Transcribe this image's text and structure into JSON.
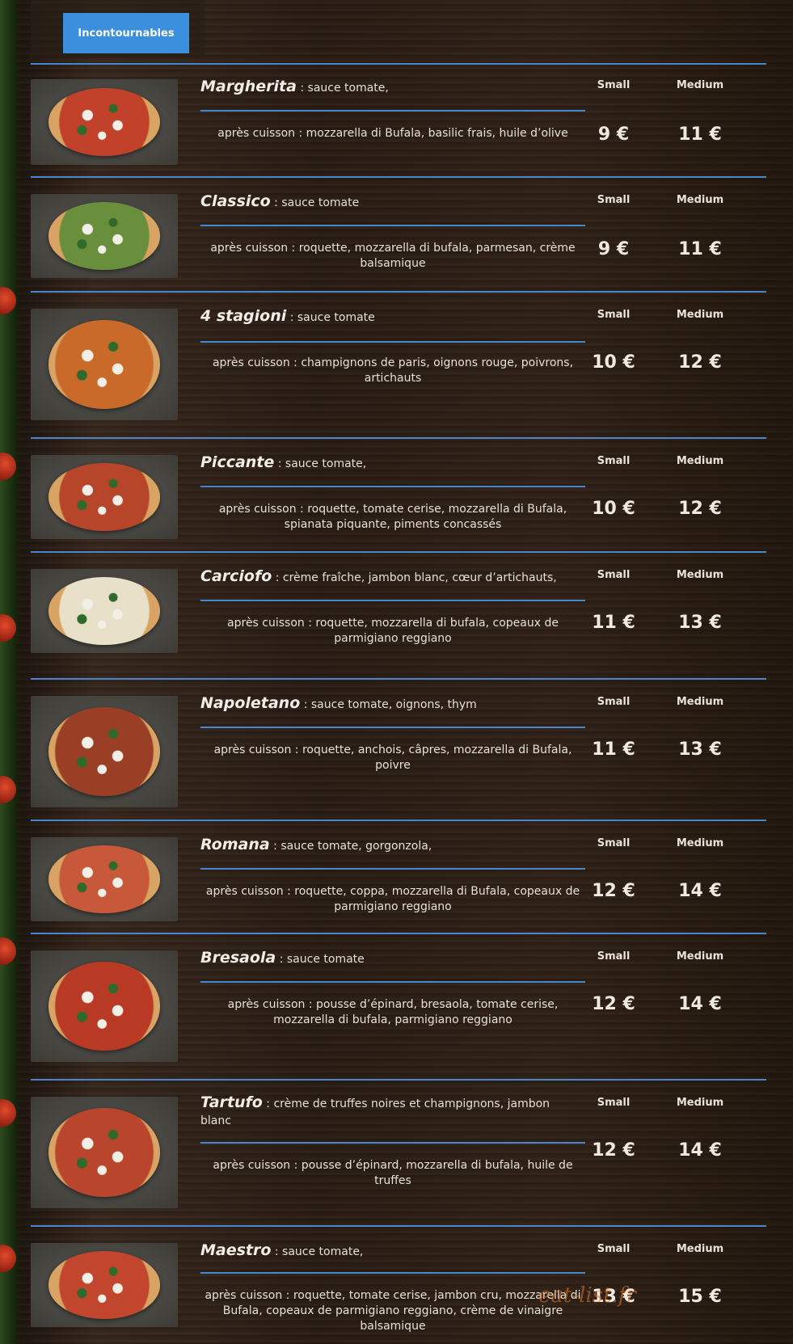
{
  "tab": {
    "label": "Incontournables"
  },
  "size_labels": {
    "small": "Small",
    "medium": "Medium"
  },
  "watermark": "eat-list.fr",
  "items": [
    {
      "name": "Margherita",
      "base": " : sauce tomate,",
      "after": "après cuisson : mozzarella di Bufala, basilic frais, huile d’olive",
      "small": "9 €",
      "medium": "11 €"
    },
    {
      "name": "Classico",
      "base": " : sauce tomate",
      "after": "après cuisson : roquette, mozzarella di bufala, parmesan, crème balsamique",
      "small": "9 €",
      "medium": "11 €"
    },
    {
      "name": "4 stagioni",
      "base": " : sauce tomate",
      "after": "après cuisson : champignons de paris, oignons rouge, poivrons, artichauts",
      "small": "10 €",
      "medium": "12 €"
    },
    {
      "name": "Piccante",
      "base": " : sauce tomate,",
      "after": "après cuisson : roquette, tomate cerise, mozzarella di Bufala, spianata piquante, piments concassés",
      "small": "10 €",
      "medium": "12 €"
    },
    {
      "name": "Carciofo",
      "base": " : crème fraîche, jambon blanc, cœur d’artichauts,",
      "after": "après cuisson : roquette, mozzarella di bufala, copeaux de parmigiano reggiano",
      "small": "11 €",
      "medium": "13 €"
    },
    {
      "name": "Napoletano",
      "base": " : sauce tomate, oignons, thym",
      "after": "après cuisson : roquette, anchois, câpres, mozzarella di Bufala, poivre",
      "small": "11 €",
      "medium": "13 €"
    },
    {
      "name": "Romana",
      "base": " : sauce tomate, gorgonzola,",
      "after": "après cuisson : roquette, coppa, mozzarella di Bufala, copeaux de parmigiano reggiano",
      "small": "12 €",
      "medium": "14 €"
    },
    {
      "name": "Bresaola",
      "base": " : sauce tomate",
      "after": "après cuisson : pousse d’épinard, bresaola, tomate cerise, mozzarella di bufala, parmigiano reggiano",
      "small": "12 €",
      "medium": "14 €"
    },
    {
      "name": "Tartufo",
      "base": " : crème de truffes noires et champignons, jambon blanc",
      "after": "après cuisson : pousse d’épinard, mozzarella di bufala, huile de truffes",
      "small": "12 €",
      "medium": "14 €"
    },
    {
      "name": "Maestro",
      "base": " : sauce tomate,",
      "after": "après cuisson : roquette, tomate cerise, jambon cru, mozzarella di Bufala, copeaux de parmigiano reggiano, crème de vinaigre balsamique",
      "small": "13 €",
      "medium": "15 €"
    }
  ]
}
